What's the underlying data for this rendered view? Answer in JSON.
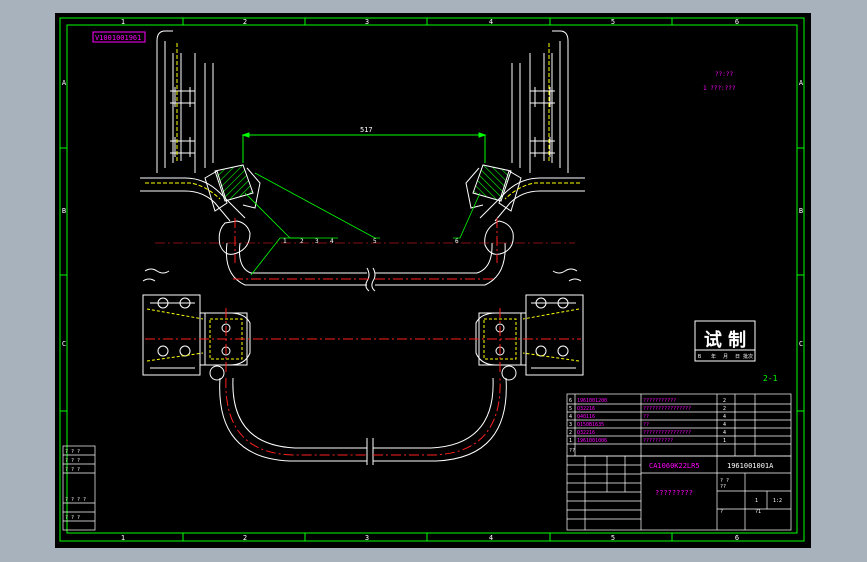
{
  "drawing": {
    "part_number_tag": "V1001001961",
    "dimension": "517",
    "sheet_label": "2-1",
    "note_line_1": "??:??",
    "note_line_2": "1  ???:???",
    "column_labels": [
      "1",
      "2",
      "3",
      "4",
      "5",
      "6"
    ],
    "row_labels": [
      "A",
      "B",
      "C"
    ],
    "balloons": [
      "1",
      "2",
      "3",
      "4",
      "5",
      "6"
    ]
  },
  "stamp": {
    "title": "试 制",
    "row": [
      "年",
      "月",
      "日",
      "批次"
    ],
    "row_prefix": "B"
  },
  "bom": {
    "rows": [
      {
        "no": "6",
        "code": "1961001200",
        "name": "???????????",
        "qty": "2"
      },
      {
        "no": "5",
        "code": "Q32216",
        "name": "????????????????",
        "qty": "2"
      },
      {
        "no": "4",
        "code": "Q40116",
        "name": "??",
        "qty": "4"
      },
      {
        "no": "3",
        "code": "Q150B1635",
        "name": "??",
        "qty": "4"
      },
      {
        "no": "2",
        "code": "Q32216",
        "name": "????????????????",
        "qty": "4"
      },
      {
        "no": "1",
        "code": "1961001006",
        "name": "??????????",
        "qty": "1"
      }
    ],
    "header_mark": "??"
  },
  "title_block": {
    "model": "CA1060K22LR5",
    "drawing_no": "1961001001A",
    "name": "?????????",
    "small_cells": [
      "? ?",
      "??",
      "1",
      "1:2",
      "?",
      "?1"
    ]
  },
  "change_block": {
    "rows": [
      "? ? ?",
      "? ? ?",
      "? ? ?",
      "? ? ? ?",
      "? ? ?"
    ]
  },
  "colors": {
    "background": "#000000",
    "frame": "#00ff00",
    "geometry": "#ffffff",
    "centerline": "#ff2020",
    "hidden": "#ffff00",
    "hatch": "#00ff00",
    "text": "#ff00ff"
  }
}
